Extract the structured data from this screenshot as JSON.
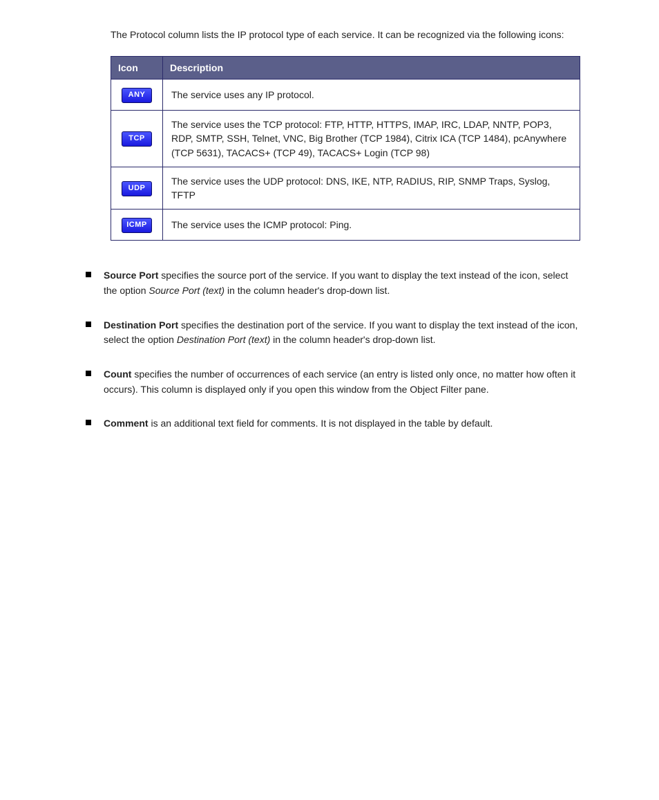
{
  "intro": "The Protocol column lists the IP protocol type of each service. It can be recognized via the following icons:",
  "table": {
    "headers": {
      "icon": "Icon",
      "desc": "Description"
    },
    "rows": [
      {
        "badge": "ANY",
        "desc_html": "The service uses any IP protocol."
      },
      {
        "badge": "TCP",
        "desc_html": "The service uses the TCP protocol: FTP, HTTP, HTTPS, IMAP, IRC, LDAP, NNTP, POP3, RDP, SMTP, SSH, Telnet, VNC, Big Brother (TCP 1984), Citrix ICA (TCP 1484), pcAnywhere (TCP 5631), TACACS+ (TCP 49), TACACS+ Login (TCP 98)"
      },
      {
        "badge": "UDP",
        "desc_html": "The service uses the UDP protocol: DNS, IKE, NTP, RADIUS, RIP, SNMP Traps, Syslog, TFTP"
      },
      {
        "badge": "ICMP",
        "desc_html": "The service uses the ICMP protocol: Ping."
      }
    ]
  },
  "fields": [
    {
      "name": "Source Port",
      "text": " specifies the source port of the service. If you want to display the text instead of the icon, select the option ",
      "opt": "Source Port (text)",
      "tail": " in the column header's drop-down list."
    },
    {
      "name": "Destination Port",
      "text": " specifies the destination port of the service. If you want to display the text instead of the icon, select the option ",
      "opt": "Destination Port (text)",
      "tail": " in the column header's drop-down list."
    },
    {
      "name": "Count",
      "text": " specifies the number of occurrences of each service (an entry is listed only once, no matter how often it occurs). This column is displayed only if you open this window from the Object Filter pane.",
      "opt": "",
      "tail": ""
    },
    {
      "name": "Comment",
      "text": " is an additional text field for comments. It is not displayed in the table by default.",
      "opt": "",
      "tail": ""
    }
  ]
}
